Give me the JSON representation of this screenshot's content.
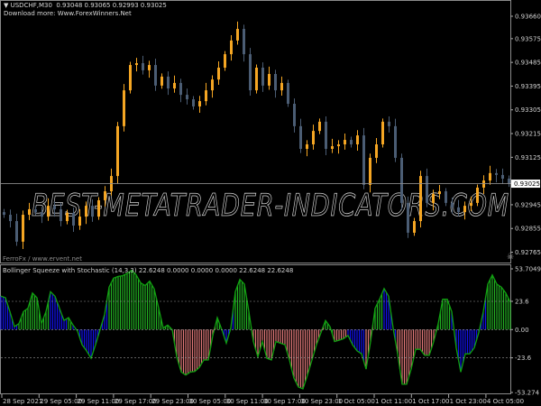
{
  "header": {
    "symbol_line": "▼ USDCHF,M30  0.93048 0.93065 0.92993 0.93025",
    "download_line": "Download more: Www.ForexWinners.Net"
  },
  "watermark": "BEST-METATRADER-INDICATORS.COM",
  "credit": "FerroFx / www.ervent.net",
  "indicator_title": "Bollinger Squeeze with Stochastic (14,3,3) 22.6248 0.0000 0.0000 0.0000 22.6248 22.6248",
  "colors": {
    "bull": "#f5a623",
    "bear": "#4b5d74",
    "hist_green": "#22b022",
    "hist_blue": "#1010ee",
    "hist_red": "#e07878",
    "line": "#10a010",
    "grid": "#9a9a9a"
  },
  "chart_data": [
    {
      "type": "candlestick",
      "symbol": "USDCHF",
      "timeframe": "M30",
      "current_price": 0.93025,
      "price_axis_labels": [
        "0.93660",
        "0.93575",
        "0.93485",
        "0.93395",
        "0.93305",
        "0.93215",
        "0.93125",
        "0.93025",
        "0.92945",
        "0.92855",
        "0.92765"
      ],
      "ylim": [
        0.92745,
        0.937
      ],
      "close": [
        0.92907,
        0.92883,
        0.92805,
        0.92907,
        0.92928,
        0.92917,
        0.929,
        0.92941,
        0.92928,
        0.92883,
        0.92914,
        0.92866,
        0.929,
        0.92941,
        0.929,
        0.92962,
        0.92996,
        0.93054,
        0.93243,
        0.93379,
        0.93475,
        0.93482,
        0.93455,
        0.93475,
        0.93397,
        0.93431,
        0.93386,
        0.93407,
        0.93362,
        0.93345,
        0.93318,
        0.93338,
        0.93379,
        0.9342,
        0.93465,
        0.93516,
        0.93568,
        0.93612,
        0.93516,
        0.93379,
        0.93465,
        0.93397,
        0.93441,
        0.93379,
        0.93407,
        0.93328,
        0.93243,
        0.93157,
        0.93174,
        0.93225,
        0.9326,
        0.93157,
        0.93167,
        0.93174,
        0.93191,
        0.93174,
        0.93208,
        0.9302,
        0.93123,
        0.93174,
        0.9326,
        0.93243,
        0.93123,
        0.92952,
        0.92839,
        0.92883,
        0.93054,
        0.92952,
        0.92986,
        0.92996,
        0.92952,
        0.92935,
        0.92917,
        0.92941,
        0.92952,
        0.9301,
        0.93037,
        0.93065,
        0.93058,
        0.93044,
        0.93025
      ]
    },
    {
      "type": "histogram",
      "title": "Bollinger Squeeze with Stochastic (14,3,3)",
      "ylim": [
        -53.274,
        53.7049
      ],
      "axis_labels": [
        "53.7049",
        "23.6",
        "0.00",
        "-23.6",
        "-53.274"
      ],
      "levels": [
        23.6,
        0,
        -23.6
      ],
      "values": [
        28,
        26.6,
        15,
        2.5,
        5,
        15,
        17.8,
        30.5,
        26.6,
        5,
        15,
        31.7,
        27.9,
        17.8,
        7.6,
        10,
        3.8,
        -1.3,
        -12.7,
        -17.8,
        -24,
        -12.7,
        0,
        12.7,
        35.5,
        43,
        44.4,
        45,
        47,
        49.5,
        45.7,
        39,
        36.8,
        40.6,
        34,
        17.8,
        1.3,
        3.8,
        0,
        -22.8,
        -35.5,
        -38,
        -35.5,
        -35,
        -31.7,
        -25.4,
        -25.4,
        -5,
        10,
        0,
        -11.4,
        1.3,
        31.7,
        41.9,
        38,
        15,
        -10,
        -22.8,
        -10,
        -24,
        -25.4,
        -10,
        -11.4,
        -12.7,
        -25.4,
        -40.6,
        -48,
        -49.5,
        -38,
        -25.4,
        -12.7,
        -2.5,
        7.6,
        2.5,
        -10,
        -8.9,
        -7.6,
        -5,
        -12.7,
        -17.8,
        -20.3,
        -33,
        -10,
        17.8,
        25.4,
        34.3,
        27.9,
        1.3,
        -20.3,
        -45.7,
        -45.7,
        -33,
        -16.5,
        -16.5,
        -21.6,
        -21.6,
        -10,
        5,
        25.4,
        25.4,
        15,
        -15.2,
        -35.5,
        -20.3,
        -20.3,
        -15.2,
        -2.5,
        15,
        38,
        45.7,
        38,
        35.5,
        30.5,
        22.8
      ],
      "bar_colors": [
        "b",
        "b",
        "b",
        "b",
        "g",
        "g",
        "g",
        "g",
        "g",
        "g",
        "g",
        "b",
        "b",
        "b",
        "b",
        "g",
        "b",
        "b",
        "b",
        "b",
        "b",
        "b",
        "b",
        "b",
        "g",
        "g",
        "g",
        "g",
        "g",
        "g",
        "g",
        "g",
        "g",
        "g",
        "g",
        "g",
        "g",
        "g",
        "r",
        "r",
        "r",
        "r",
        "r",
        "r",
        "r",
        "r",
        "r",
        "r",
        "g",
        "b",
        "b",
        "b",
        "g",
        "g",
        "g",
        "g",
        "r",
        "r",
        "r",
        "r",
        "r",
        "r",
        "r",
        "r",
        "r",
        "r",
        "r",
        "r",
        "r",
        "r",
        "r",
        "r",
        "g",
        "g",
        "r",
        "r",
        "r",
        "b",
        "b",
        "b",
        "b",
        "r",
        "r",
        "g",
        "g",
        "b",
        "b",
        "b",
        "r",
        "r",
        "r",
        "r",
        "r",
        "r",
        "r",
        "r",
        "r",
        "g",
        "g",
        "g",
        "b",
        "b",
        "b",
        "b",
        "b",
        "b",
        "b",
        "b",
        "g",
        "g",
        "g",
        "g",
        "g",
        "g"
      ]
    }
  ],
  "time_axis": [
    "28 Sep 2021",
    "29 Sep 05:00",
    "29 Sep 11:00",
    "29 Sep 17:00",
    "29 Sep 23:00",
    "30 Sep 05:00",
    "30 Sep 11:00",
    "30 Sep 17:00",
    "30 Sep 23:00",
    "1 Oct 05:00",
    "1 Oct 11:00",
    "1 Oct 17:00",
    "1 Oct 23:00",
    "4 Oct 05:00"
  ]
}
